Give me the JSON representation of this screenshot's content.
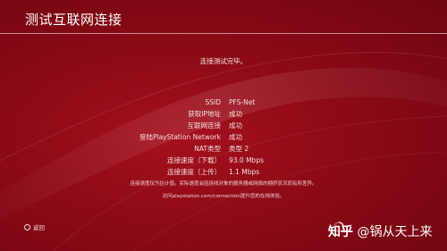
{
  "header": {
    "title": "测试互联网连接"
  },
  "status": {
    "complete": "连接测试完毕。"
  },
  "results": [
    {
      "label": "SSID",
      "value": "PFS-Net"
    },
    {
      "label": "获取IP地址",
      "value": "成功"
    },
    {
      "label": "互联网连接",
      "value": "成功"
    },
    {
      "label": "登陆PlayStation Network",
      "value": "成功"
    },
    {
      "label": "NAT类型",
      "value": "类型 2"
    },
    {
      "label": "连接速度（下载）",
      "value": "93.0 Mbps"
    },
    {
      "label": "连接速度（上传）",
      "value": "1.1 Mbps"
    }
  ],
  "notes": {
    "disclaimer": "连接速度仅为估计值。实际速度会因连线对象的服务器或网络的拥挤状况而有所差异。",
    "visit": "访问playstation.com/connection提升您的在线体验。"
  },
  "footer": {
    "back_label": "返回",
    "back_icon": "circle-button-icon"
  },
  "watermark": {
    "brand": "知乎",
    "handle": "@锅从天上来"
  },
  "colors": {
    "background": "#8c0a16",
    "text": "#f3dede"
  }
}
